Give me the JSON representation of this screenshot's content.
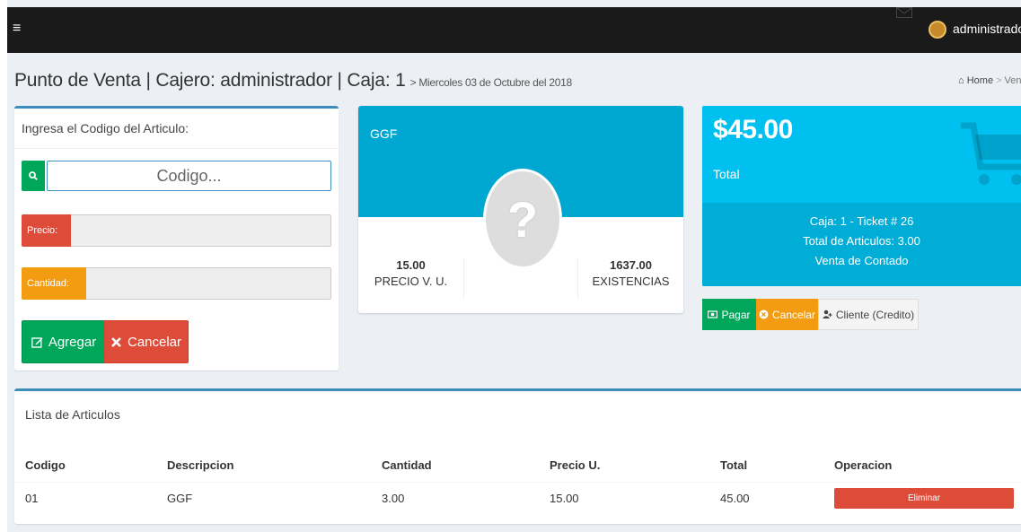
{
  "topbar": {
    "menu_icon": "≡",
    "user_name": "administrador"
  },
  "header": {
    "title": "Punto de Venta | Cajero: administrador | Caja: 1",
    "date": "> Miercoles 03 de Octubre del 2018",
    "breadcrumb_home": "Home",
    "breadcrumb_current": "Vent"
  },
  "entry_form": {
    "title": "Ingresa el Codigo del Articulo:",
    "code_placeholder": "Codigo...",
    "price_label": "Precio:",
    "quantity_label": "Cantidad:",
    "add_button": "Agregar",
    "cancel_button": "Cancelar"
  },
  "product": {
    "name": "GGF",
    "price_value": "15.00",
    "price_label": "PRECIO V. U.",
    "stock_value": "1637.00",
    "stock_label": "EXISTENCIAS",
    "placeholder_symbol": "?"
  },
  "summary": {
    "total_amount": "$45.00",
    "total_label": "Total",
    "ticket_line": "Caja: 1 - Ticket # 26",
    "items_line": "Total de Articulos: 3.00",
    "sale_type_line": "Venta de Contado"
  },
  "actions": {
    "pay": "Pagar",
    "cancel": "Cancelar",
    "client_credit": "Cliente (Credito)"
  },
  "list": {
    "title": "Lista de Articulos",
    "columns": [
      "Codigo",
      "Descripcion",
      "Cantidad",
      "Precio U.",
      "Total",
      "Operacion"
    ],
    "rows": [
      {
        "codigo": "01",
        "descripcion": "GGF",
        "cantidad": "3.00",
        "precio": "15.00",
        "total": "45.00",
        "action": "Eliminar"
      }
    ]
  },
  "colors": {
    "primary": "#3c8dbc",
    "success": "#00a65a",
    "danger": "#dd4b39",
    "warning": "#f39c12",
    "info": "#00c0ef",
    "topbar": "#1a1a1a"
  }
}
